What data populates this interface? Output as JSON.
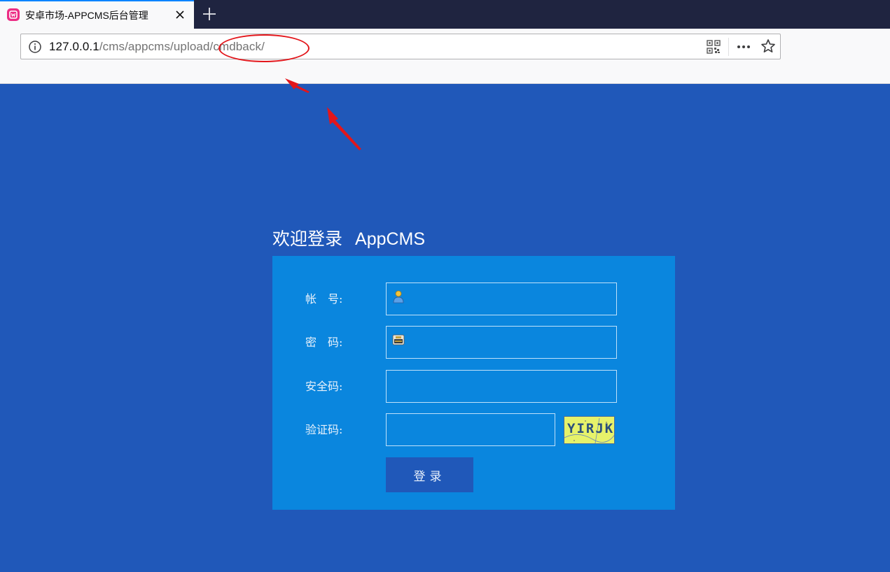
{
  "browser": {
    "tab": {
      "title": "安卓市场-APPCMS后台管理",
      "favicon": "appcms-favicon-icon"
    },
    "urlbar": {
      "host": "127.0.0.1",
      "path": "/cms/appcms/upload/cmdback/"
    },
    "icons": [
      "info-icon",
      "close-icon",
      "plus-icon",
      "qr-code-icon",
      "more-icon",
      "star-icon"
    ],
    "colors": {
      "tabstrip": "#1f2440",
      "accent": "#0a84ff"
    }
  },
  "annotations": {
    "color": "#e3161b",
    "shapes": [
      "ellipse",
      "arrow",
      "arrow"
    ]
  },
  "login": {
    "heading": "欢迎登录",
    "brand": "AppCMS",
    "fields": {
      "account_label": "帐　号:",
      "password_label": "密　码:",
      "security_label": "安全码:",
      "captcha_label": "验证码:"
    },
    "captcha_text": "YIRJK",
    "submit_label": "登录",
    "colors": {
      "page_bg": "#2058b9",
      "panel_bg": "#0a86de",
      "button_bg": "#2058b9",
      "captcha_bg": "#e6f26a"
    }
  }
}
